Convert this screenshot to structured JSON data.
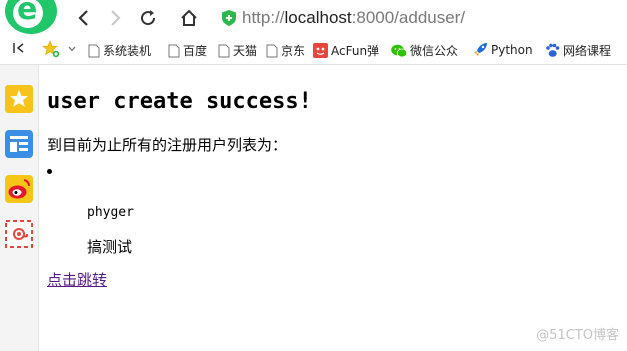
{
  "toolbar": {
    "url_scheme": "http://",
    "url_host": "localhost",
    "url_rest": ":8000/adduser/"
  },
  "bookmarks": {
    "items": [
      {
        "label": "系统装机",
        "icon": "page-icon"
      },
      {
        "label": "百度",
        "icon": "page-icon"
      },
      {
        "label": "天猫",
        "icon": "page-icon"
      },
      {
        "label": "京东",
        "icon": "page-icon"
      },
      {
        "label": "AcFun弹",
        "icon": "acfun-icon"
      },
      {
        "label": "微信公众",
        "icon": "wechat-icon"
      },
      {
        "label": "Python",
        "icon": "rocket-icon"
      },
      {
        "label": "网络课程",
        "icon": "paw-icon"
      }
    ]
  },
  "page": {
    "title": "user create success!",
    "intro": "到目前为止所有的注册用户列表为：",
    "users": [
      "phyger",
      "搞测试"
    ],
    "link": "点击跳转"
  },
  "watermark": "@51CTO博客",
  "colors": {
    "brand_green": "#1fc76a",
    "link_visited": "#551a8b",
    "shield_green": "#2db84d"
  }
}
